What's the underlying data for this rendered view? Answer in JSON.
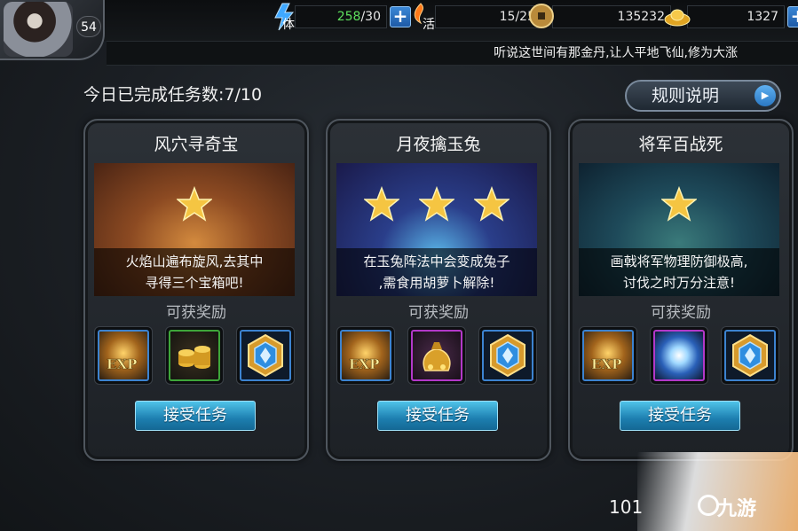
{
  "player": {
    "level": "54"
  },
  "stats": {
    "stamina": {
      "icon": "stamina-lightning-icon",
      "char": "体",
      "current": "258",
      "max": " /30"
    },
    "vitality": {
      "icon": "vitality-flame-icon",
      "char": "活",
      "current": "15",
      "max": "/25"
    },
    "coins": {
      "icon": "copper-coin-icon",
      "value": "135232"
    },
    "ingots": {
      "icon": "gold-ingot-icon",
      "value": "1327"
    },
    "plus_label": "+"
  },
  "ticker": {
    "text": "听说这世间有那金丹,让人平地飞仙,修为大涨"
  },
  "header": {
    "completed_label": "今日已完成任务数:7/10",
    "rules_button": "规则说明"
  },
  "reward_label": "可获奖励",
  "accept_label": "接受任务",
  "quests": [
    {
      "title": "风穴寻奇宝",
      "stars": 1,
      "desc_line1": "火焰山遍布旋风,去其中",
      "desc_line2": "寻得三个宝箱吧!",
      "rewards": [
        "exp-potion-icon",
        "gold-coins-stack-icon",
        "blue-gem-medal-icon"
      ]
    },
    {
      "title": "月夜擒玉兔",
      "stars": 3,
      "desc_line1": "在玉兔阵法中会变成兔子",
      "desc_line2": ",需食用胡萝卜解除!",
      "rewards": [
        "exp-potion-icon",
        "gold-sack-icon",
        "blue-gem-medal-icon"
      ]
    },
    {
      "title": "将军百战死",
      "stars": 1,
      "desc_line1": "画戟将军物理防御极高,",
      "desc_line2": "讨伐之时万分注意!",
      "rewards": [
        "exp-potion-icon",
        "glowing-orb-icon",
        "blue-gem-medal-icon"
      ]
    }
  ],
  "page_number": "101",
  "watermark": {
    "text": "九游"
  },
  "colors": {
    "accent_blue": "#1d7fb0",
    "star_gold": "#f5c542",
    "green_value": "#5ee05e"
  }
}
